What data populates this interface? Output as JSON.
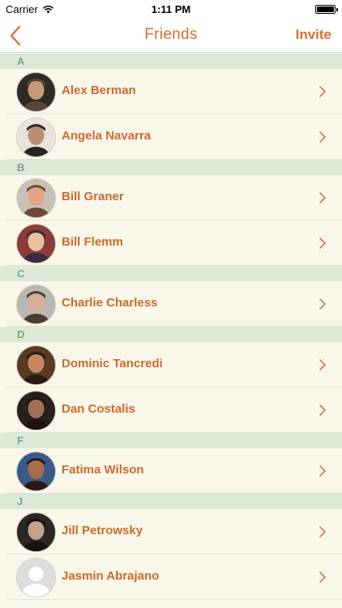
{
  "status_bar": {
    "carrier": "Carrier",
    "time": "1:11 PM"
  },
  "nav": {
    "title": "Friends",
    "invite_label": "Invite"
  },
  "accent_color": "#d46f2e",
  "section_color": "#dde9d7",
  "sections": [
    {
      "letter": "A",
      "friends": [
        {
          "name": "Alex Berman"
        },
        {
          "name": "Angela Navarra"
        }
      ]
    },
    {
      "letter": "B",
      "friends": [
        {
          "name": "Bill Graner"
        },
        {
          "name": "Bill Flemm"
        }
      ]
    },
    {
      "letter": "C",
      "friends": [
        {
          "name": "Charlie Charless"
        }
      ]
    },
    {
      "letter": "D",
      "friends": [
        {
          "name": "Dominic Tancredi"
        },
        {
          "name": "Dan Costalis"
        }
      ]
    },
    {
      "letter": "F",
      "friends": [
        {
          "name": "Fatima Wilson"
        }
      ]
    },
    {
      "letter": "J",
      "friends": [
        {
          "name": "Jill Petrowsky"
        },
        {
          "name": "Jasmin Abrajano"
        }
      ]
    }
  ]
}
